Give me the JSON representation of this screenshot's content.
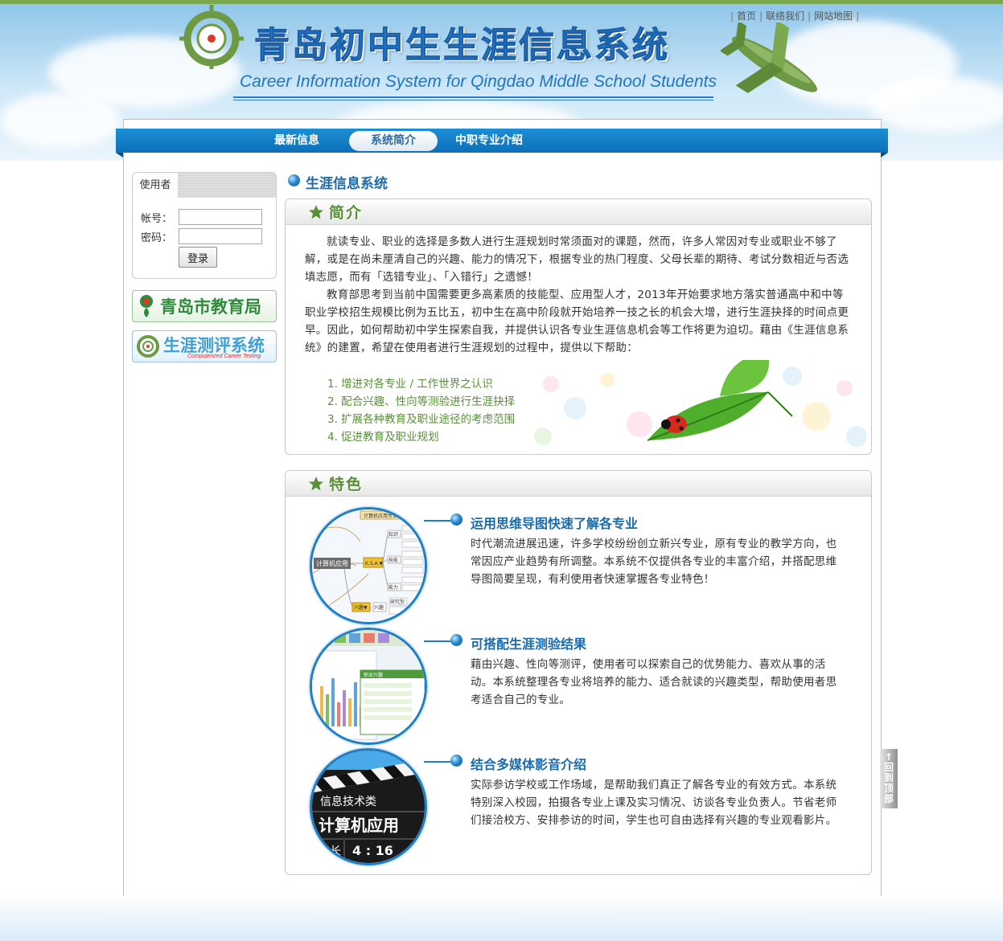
{
  "header": {
    "title": "青岛初中生生涯信息系统",
    "subtitle": "Career Information System for Qingdao Middle School Students",
    "links": [
      "首页",
      "联络我们",
      "网站地图"
    ]
  },
  "nav": {
    "items": [
      {
        "label": "最新信息",
        "active": false
      },
      {
        "label": "系统简介",
        "active": true
      },
      {
        "label": "中职专业介绍",
        "active": false
      }
    ]
  },
  "login": {
    "tab_label": "使用者",
    "account_label": "帐号：",
    "account_value": "",
    "password_label": "密码：",
    "password_value": "",
    "submit_label": "登录"
  },
  "sidebar_banners": [
    {
      "label": "青岛市教育局",
      "sub": "",
      "color": "#2e8b3a"
    },
    {
      "label": "生涯测评系统",
      "sub": "Computerized Career Testing",
      "color": "#3fa0d8"
    }
  ],
  "content": {
    "section_title": "生涯信息系统",
    "intro": {
      "heading": "简介",
      "paragraphs": [
        "就读专业、职业的选择是多数人进行生涯规划时常须面对的课题，然而，许多人常因对专业或职业不够了解，或是在尚未厘清自己的兴趣、能力的情况下，根据专业的热门程度、父母长辈的期待、考试分数相近与否选填志愿，而有「选错专业」、「入错行」之遗憾！",
        "教育部思考到当前中国需要更多高素质的技能型、应用型人才，2013年开始要求地方落实普通高中和中等职业学校招生规模比例为五比五，初中生在高中阶段就开始培养一技之长的机会大增，进行生涯抉择的时间点更早。因此，如何帮助初中学生探索自我，并提供认识各专业生涯信息机会等工作将更为迫切。藉由《生涯信息系统》的建置，希望在使用者进行生涯规划的过程中，提供以下帮助："
      ],
      "list": [
        "1. 增进对各专业 / 工作世界之认识",
        "2. 配合兴趣、性向等测验进行生涯抉择",
        "3. 扩展各种教育及职业途径的考虑范围",
        "4. 促进教育及职业规划"
      ]
    },
    "features": {
      "heading": "特色",
      "items": [
        {
          "title": "运用思维导图快速了解各专业",
          "desc": "时代潮流进展迅速，许多学校纷纷创立新兴专业，原有专业的教学方向，也常因应产业趋势有所调整。本系统不仅提供各专业的丰富介绍，并搭配思维导图简要呈现，有利使用者快速掌握各专业特色！",
          "image_labels": [
            "计算机应用",
            "K.S.A.▼",
            "知识",
            "技能",
            "能力",
            "兴趣▼",
            "兴趣",
            "研究型",
            "计算机应用专业简介"
          ]
        },
        {
          "title": "可搭配生涯测验结果",
          "desc": "藉由兴趣、性向等测评，使用者可以探索自己的优势能力、喜欢从事的活动。本系统整理各专业将培养的能力、适合就读的兴趣类型，帮助使用者思考适合自己的专业。",
          "image_labels": [
            "职业兴趣"
          ]
        },
        {
          "title": "结合多媒体影音介绍",
          "desc": "实际参访学校或工作场域，是帮助我们真正了解各专业的有效方式。本系统特别深入校园，拍摄各专业上课及实习情况、访谈各专业负责人。节省老师们接洽校方、安排参访的时间，学生也可自由选择有兴趣的专业观看影片。",
          "image_labels": [
            "信息技术类",
            "计算机应用",
            "长",
            "4 : 16"
          ]
        }
      ]
    }
  },
  "back_to_top": "回到顶部",
  "colors": {
    "brand_blue": "#1f6aa5",
    "nav_blue": "#0d6fb8",
    "accent_green": "#5a8f3a"
  }
}
